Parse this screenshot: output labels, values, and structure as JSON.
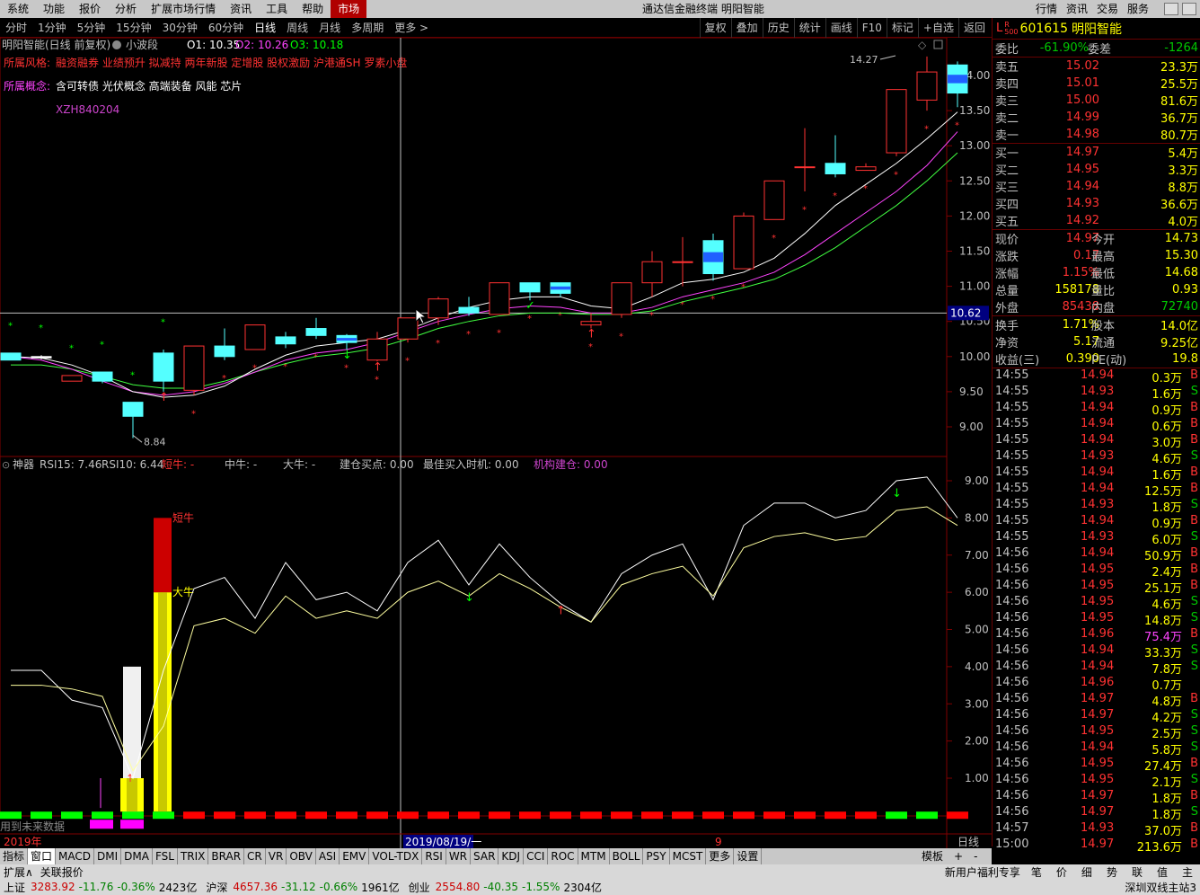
{
  "menu": [
    "系统",
    "功能",
    "报价",
    "分析",
    "扩展市场行情",
    "资讯",
    "工具",
    "帮助",
    "市场"
  ],
  "app_title": "通达信金融终端  明阳智能",
  "right_menu": [
    "行情",
    "资讯",
    "交易",
    "服务"
  ],
  "periods": [
    "分时",
    "1分钟",
    "5分钟",
    "15分钟",
    "30分钟",
    "60分钟",
    "日线",
    "周线",
    "月线",
    "多周期",
    "更多 >"
  ],
  "tool_buttons": [
    "复权",
    "叠加",
    "历史",
    "统计",
    "画线",
    "F10",
    "标记",
    "+自选",
    "返回"
  ],
  "chart_info": {
    "title": "明阳智能(日线 前复权)",
    "indicator": "小波段",
    "o1": "O1: 10.35",
    "o2": "O2: 10.26",
    "o3": "O3: 10.18",
    "style_label": "所属风格:",
    "style_text": "融资融券 业绩预升 拟减持 两年新股 定增股 股权激励 沪港通SH 罗素小盘",
    "concept_label": "所属概念:",
    "concept_text": "含可转债 光伏概念 高端装备 风能 芯片",
    "code_text": "XZH840204",
    "high_mark": "14.27",
    "low_mark": "8.84",
    "cross_price": "10.62"
  },
  "price_axis": [
    "14.00",
    "13.50",
    "13.00",
    "12.50",
    "12.00",
    "11.50",
    "11.00",
    "10.50",
    "10.00",
    "9.50",
    "9.00"
  ],
  "ind_axis": [
    "9.00",
    "8.00",
    "7.00",
    "6.00",
    "5.00",
    "4.00",
    "3.00",
    "2.00",
    "1.00"
  ],
  "indicator_info": {
    "name": "神器",
    "rsi15": "RSI15: 7.46",
    "rsi10": "RSI10: 6.44",
    "short_bull": "短牛: -",
    "mid_bull": "中牛: -",
    "big_bull": "大牛: -",
    "build_buy": "建仓买点: 0.00",
    "best_buy": "最佳买入时机: 0.00",
    "inst_build": "机构建仓: 0.00",
    "label_short": "短牛",
    "label_big": "大牛",
    "future_note": "用到未来数据"
  },
  "date_axis": {
    "left": "2019年",
    "cursor": "2019/08/19/一",
    "right": "9",
    "period": "日线"
  },
  "quote": {
    "code": "601615",
    "name": "明阳智能",
    "wb_label": "委比",
    "wb": "-61.90%",
    "wc_label": "委差",
    "wc": "-1264",
    "sell": [
      {
        "label": "卖五",
        "price": "15.02",
        "vol": "23.3万"
      },
      {
        "label": "卖四",
        "price": "15.01",
        "vol": "25.5万"
      },
      {
        "label": "卖三",
        "price": "15.00",
        "vol": "81.6万"
      },
      {
        "label": "卖二",
        "price": "14.99",
        "vol": "36.7万"
      },
      {
        "label": "卖一",
        "price": "14.98",
        "vol": "80.7万"
      }
    ],
    "buy": [
      {
        "label": "买一",
        "price": "14.97",
        "vol": "5.4万"
      },
      {
        "label": "买二",
        "price": "14.95",
        "vol": "3.3万"
      },
      {
        "label": "买三",
        "price": "14.94",
        "vol": "8.8万"
      },
      {
        "label": "买四",
        "price": "14.93",
        "vol": "36.6万"
      },
      {
        "label": "买五",
        "price": "14.92",
        "vol": "4.0万"
      }
    ],
    "stats": [
      {
        "l1": "现价",
        "v1": "14.97",
        "l2": "今开",
        "v2": "14.73"
      },
      {
        "l1": "涨跌",
        "v1": "0.17",
        "l2": "最高",
        "v2": "15.30"
      },
      {
        "l1": "涨幅",
        "v1": "1.15%",
        "l2": "最低",
        "v2": "14.68"
      },
      {
        "l1": "总量",
        "v1": "158178",
        "l2": "量比",
        "v2": "0.93"
      },
      {
        "l1": "外盘",
        "v1": "85438",
        "l2": "内盘",
        "v2": "72740"
      }
    ],
    "stats2": [
      {
        "l1": "换手",
        "v1": "1.71%",
        "l2": "股本",
        "v2": "14.0亿"
      },
      {
        "l1": "净资",
        "v1": "5.17",
        "l2": "流通",
        "v2": "9.25亿"
      },
      {
        "l1": "收益(三)",
        "v1": "0.390",
        "l2": "PE(动)",
        "v2": "19.8"
      }
    ]
  },
  "ticks": [
    {
      "t": "14:55",
      "p": "14.94",
      "v": "0.3万",
      "s": "B"
    },
    {
      "t": "14:55",
      "p": "14.93",
      "v": "1.6万",
      "s": "S"
    },
    {
      "t": "14:55",
      "p": "14.94",
      "v": "0.9万",
      "s": "B"
    },
    {
      "t": "14:55",
      "p": "14.94",
      "v": "0.6万",
      "s": "B"
    },
    {
      "t": "14:55",
      "p": "14.94",
      "v": "3.0万",
      "s": "B"
    },
    {
      "t": "14:55",
      "p": "14.93",
      "v": "4.6万",
      "s": "S"
    },
    {
      "t": "14:55",
      "p": "14.94",
      "v": "1.6万",
      "s": "B"
    },
    {
      "t": "14:55",
      "p": "14.94",
      "v": "12.5万",
      "s": "B"
    },
    {
      "t": "14:55",
      "p": "14.93",
      "v": "1.8万",
      "s": "S"
    },
    {
      "t": "14:55",
      "p": "14.94",
      "v": "0.9万",
      "s": "B"
    },
    {
      "t": "14:55",
      "p": "14.93",
      "v": "6.0万",
      "s": "S"
    },
    {
      "t": "14:56",
      "p": "14.94",
      "v": "50.9万",
      "s": "B"
    },
    {
      "t": "14:56",
      "p": "14.95",
      "v": "2.4万",
      "s": "B"
    },
    {
      "t": "14:56",
      "p": "14.95",
      "v": "25.1万",
      "s": "B"
    },
    {
      "t": "14:56",
      "p": "14.95",
      "v": "4.6万",
      "s": "S"
    },
    {
      "t": "14:56",
      "p": "14.95",
      "v": "14.8万",
      "s": "S"
    },
    {
      "t": "14:56",
      "p": "14.96",
      "v": "75.4万",
      "s": "B"
    },
    {
      "t": "14:56",
      "p": "14.94",
      "v": "33.3万",
      "s": "S"
    },
    {
      "t": "14:56",
      "p": "14.94",
      "v": "7.8万",
      "s": "S"
    },
    {
      "t": "14:56",
      "p": "14.96",
      "v": "0.7万",
      "s": ""
    },
    {
      "t": "14:56",
      "p": "14.97",
      "v": "4.8万",
      "s": "B"
    },
    {
      "t": "14:56",
      "p": "14.97",
      "v": "4.2万",
      "s": "S"
    },
    {
      "t": "14:56",
      "p": "14.95",
      "v": "2.5万",
      "s": "S"
    },
    {
      "t": "14:56",
      "p": "14.94",
      "v": "5.8万",
      "s": "S"
    },
    {
      "t": "14:56",
      "p": "14.95",
      "v": "27.4万",
      "s": "B"
    },
    {
      "t": "14:56",
      "p": "14.95",
      "v": "2.1万",
      "s": "S"
    },
    {
      "t": "14:56",
      "p": "14.97",
      "v": "1.8万",
      "s": "B"
    },
    {
      "t": "14:56",
      "p": "14.97",
      "v": "1.8万",
      "s": "S"
    },
    {
      "t": "14:57",
      "p": "14.93",
      "v": "37.0万",
      "s": "B"
    },
    {
      "t": "15:00",
      "p": "14.97",
      "v": "213.6万",
      "s": "B"
    }
  ],
  "tabs": [
    "指标",
    "窗口",
    "MACD",
    "DMI",
    "DMA",
    "FSL",
    "TRIX",
    "BRAR",
    "CR",
    "VR",
    "OBV",
    "ASI",
    "EMV",
    "VOL-TDX",
    "RSI",
    "WR",
    "SAR",
    "KDJ",
    "CCI",
    "ROC",
    "MTM",
    "BOLL",
    "PSY",
    "MCST",
    "更多",
    "设置"
  ],
  "tabs_right": [
    "模板",
    "+",
    "-"
  ],
  "ext_bar": [
    "扩展∧",
    "关联报价"
  ],
  "ext_right": [
    "新用户福利专享",
    "笔",
    "价",
    "细",
    "势",
    "联",
    "值",
    "主"
  ],
  "status": [
    {
      "label": "上证",
      "value": "3283.92",
      "chg": "-11.76",
      "pct": "-0.36%",
      "amt": "2423亿"
    },
    {
      "label": "沪深",
      "value": "4657.36",
      "chg": "-31.12",
      "pct": "-0.66%",
      "amt": "1961亿"
    },
    {
      "label": "创业",
      "value": "2554.80",
      "chg": "-40.35",
      "pct": "-1.55%",
      "amt": "2304亿"
    }
  ],
  "status_right": "深圳双线主站3",
  "chart_data": {
    "type": "candlestick",
    "title": "明阳智能(日线 前复权)",
    "ylim": [
      8.75,
      14.3
    ],
    "candles": [
      {
        "o": 10.05,
        "h": 10.05,
        "c": 9.95,
        "l": 9.95,
        "col": "c"
      },
      {
        "o": 10.0,
        "h": 10.02,
        "c": 9.98,
        "l": 9.96,
        "col": "w"
      },
      {
        "o": 9.73,
        "h": 9.73,
        "c": 9.65,
        "l": 9.65,
        "col": "r"
      },
      {
        "o": 9.78,
        "h": 9.78,
        "c": 9.65,
        "l": 9.62,
        "col": "c"
      },
      {
        "o": 9.35,
        "h": 9.35,
        "c": 9.15,
        "l": 8.84,
        "col": "c"
      },
      {
        "o": 10.05,
        "h": 10.1,
        "c": 9.65,
        "l": 9.5,
        "col": "c"
      },
      {
        "o": 9.52,
        "h": 10.15,
        "c": 10.15,
        "l": 9.45,
        "col": "r"
      },
      {
        "o": 10.15,
        "h": 10.4,
        "c": 10.0,
        "l": 9.95,
        "col": "c"
      },
      {
        "o": 10.1,
        "h": 10.45,
        "c": 10.45,
        "l": 10.1,
        "col": "r"
      },
      {
        "o": 10.28,
        "h": 10.35,
        "c": 10.18,
        "l": 10.12,
        "col": "c"
      },
      {
        "o": 10.4,
        "h": 10.55,
        "c": 10.3,
        "l": 10.25,
        "col": "c"
      },
      {
        "o": 10.3,
        "h": 10.32,
        "c": 10.2,
        "l": 10.1,
        "col": "b"
      },
      {
        "o": 9.95,
        "h": 10.35,
        "c": 10.25,
        "l": 9.93,
        "col": "r"
      },
      {
        "o": 10.25,
        "h": 10.55,
        "c": 10.55,
        "l": 10.2,
        "col": "r"
      },
      {
        "o": 10.55,
        "h": 10.85,
        "c": 10.82,
        "l": 10.45,
        "col": "r"
      },
      {
        "o": 10.7,
        "h": 10.85,
        "c": 10.62,
        "l": 10.58,
        "col": "c"
      },
      {
        "o": 10.6,
        "h": 11.05,
        "c": 11.05,
        "l": 10.6,
        "col": "r"
      },
      {
        "o": 11.05,
        "h": 11.05,
        "c": 10.92,
        "l": 10.8,
        "col": "c"
      },
      {
        "o": 11.05,
        "h": 11.05,
        "c": 10.9,
        "l": 10.85,
        "col": "b"
      },
      {
        "o": 10.5,
        "h": 10.62,
        "c": 10.45,
        "l": 10.4,
        "col": "r"
      },
      {
        "o": 10.6,
        "h": 11.05,
        "c": 11.05,
        "l": 10.55,
        "col": "r"
      },
      {
        "o": 11.05,
        "h": 11.5,
        "c": 11.35,
        "l": 10.85,
        "col": "r"
      },
      {
        "o": 11.35,
        "h": 11.7,
        "c": 11.35,
        "l": 11.0,
        "col": "r"
      },
      {
        "o": 11.65,
        "h": 11.75,
        "c": 11.18,
        "l": 11.08,
        "col": "cb"
      },
      {
        "o": 11.25,
        "h": 12.05,
        "c": 12.0,
        "l": 11.25,
        "col": "r"
      },
      {
        "o": 11.95,
        "h": 12.5,
        "c": 12.5,
        "l": 11.95,
        "col": "r"
      },
      {
        "o": 12.7,
        "h": 13.25,
        "c": 12.7,
        "l": 12.35,
        "col": "r"
      },
      {
        "o": 12.75,
        "h": 13.15,
        "c": 12.6,
        "l": 12.55,
        "col": "c"
      },
      {
        "o": 12.7,
        "h": 12.75,
        "c": 12.65,
        "l": 12.65,
        "col": "r"
      },
      {
        "o": 12.9,
        "h": 13.8,
        "c": 13.8,
        "l": 12.85,
        "col": "r"
      },
      {
        "o": 13.65,
        "h": 14.27,
        "c": 14.05,
        "l": 13.5,
        "col": "r"
      },
      {
        "o": 14.15,
        "h": 14.2,
        "c": 13.75,
        "l": 13.55,
        "col": "cb"
      }
    ],
    "ma_white": [
      10.0,
      9.98,
      9.88,
      9.72,
      9.5,
      9.42,
      9.45,
      9.58,
      9.82,
      10.02,
      10.15,
      10.2,
      10.25,
      10.38,
      10.55,
      10.7,
      10.8,
      10.85,
      10.85,
      10.72,
      10.68,
      10.85,
      11.05,
      11.1,
      11.2,
      11.4,
      11.75,
      12.15,
      12.45,
      12.75,
      13.1,
      13.48
    ],
    "ma_magenta": [
      10.0,
      9.95,
      9.82,
      9.65,
      9.5,
      9.45,
      9.5,
      9.62,
      9.78,
      9.95,
      10.05,
      10.1,
      10.2,
      10.35,
      10.5,
      10.6,
      10.68,
      10.72,
      10.7,
      10.62,
      10.62,
      10.7,
      10.85,
      10.95,
      11.05,
      11.2,
      11.45,
      11.75,
      12.05,
      12.35,
      12.72,
      13.2
    ],
    "ma_green": [
      9.88,
      9.88,
      9.82,
      9.72,
      9.6,
      9.55,
      9.55,
      9.65,
      9.78,
      9.9,
      10.0,
      10.05,
      10.12,
      10.25,
      10.4,
      10.5,
      10.58,
      10.62,
      10.62,
      10.6,
      10.6,
      10.65,
      10.78,
      10.88,
      10.98,
      11.1,
      11.3,
      11.55,
      11.85,
      12.15,
      12.5,
      12.9
    ],
    "rsi_a": [
      3.9,
      3.9,
      3.1,
      2.9,
      1.0,
      3.9,
      6.1,
      6.4,
      5.3,
      6.8,
      5.8,
      6.0,
      5.5,
      6.8,
      7.4,
      6.2,
      7.3,
      6.4,
      5.7,
      5.2,
      6.5,
      7.0,
      7.3,
      5.8,
      7.8,
      8.4,
      8.4,
      8.0,
      8.2,
      9.0,
      9.1,
      8.0
    ],
    "rsi_b": [
      3.5,
      3.5,
      3.4,
      3.2,
      1.2,
      2.4,
      5.1,
      5.3,
      4.9,
      5.9,
      5.3,
      5.5,
      5.3,
      6.0,
      6.3,
      5.9,
      6.5,
      6.1,
      5.6,
      5.2,
      6.2,
      6.5,
      6.7,
      5.9,
      7.2,
      7.5,
      7.6,
      7.4,
      7.5,
      8.2,
      8.3,
      7.8
    ]
  },
  "colors": {
    "up": "#ff3232",
    "down": "#54ffff",
    "bg": "#000000",
    "grid": "#800000"
  }
}
